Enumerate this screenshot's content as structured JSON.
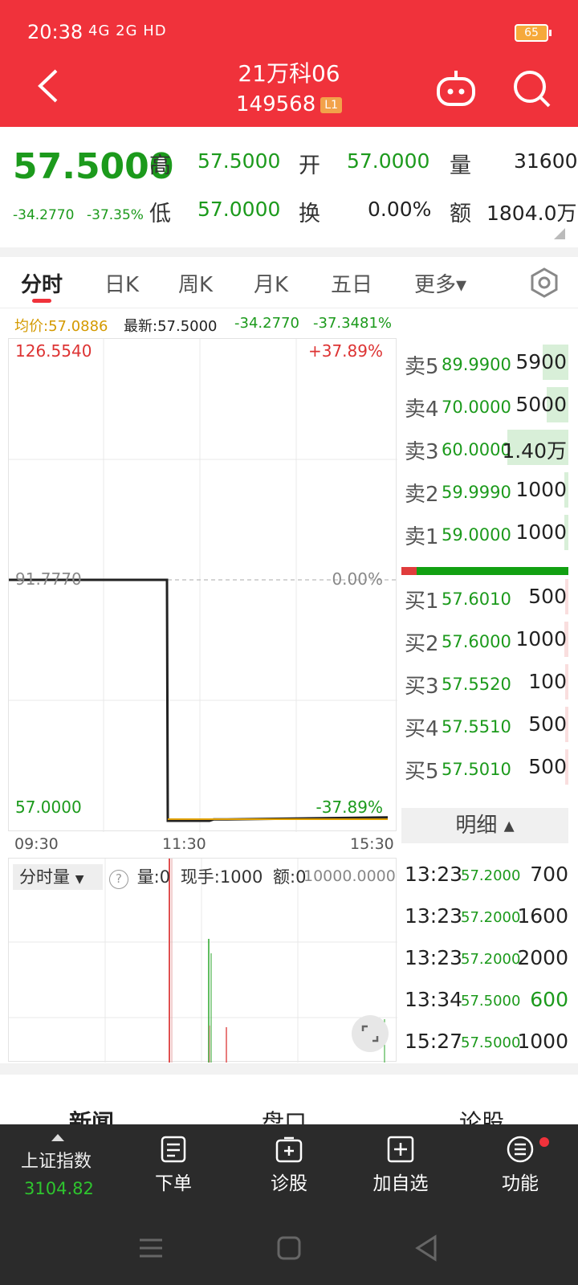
{
  "status_bar": {
    "time": "20:38",
    "signal_text": "4G 2G HD",
    "battery": "65"
  },
  "header": {
    "stock_name": "21万科06",
    "stock_code": "149568",
    "level_badge": "L1"
  },
  "quote": {
    "price": "57.5000",
    "change": "-34.2770",
    "change_pct": "-37.35%",
    "high_label": "高",
    "high": "57.5000",
    "open_label": "开",
    "open": "57.0000",
    "volume_label": "量",
    "volume": "31600",
    "low_label": "低",
    "low": "57.0000",
    "turnover_label": "换",
    "turnover": "0.00%",
    "amount_label": "额",
    "amount": "1804.0万"
  },
  "tabs": [
    "分时",
    "日K",
    "周K",
    "月K",
    "五日",
    "更多▾"
  ],
  "legend": {
    "avg": "均价:57.0886",
    "latest": "最新:57.5000",
    "chg": "-34.2770",
    "pct": "-37.3481%"
  },
  "chart_data": {
    "type": "line",
    "y_top": "126.5540",
    "y_mid": "91.7770",
    "y_bottom": "57.0000",
    "pct_top": "+37.89%",
    "pct_mid": "0.00%",
    "pct_bottom": "-37.89%",
    "x_labels": [
      "09:30",
      "11:30",
      "15:30"
    ],
    "ylim": [
      57.0,
      126.554
    ],
    "series": [
      {
        "values": [
          91.777,
          91.777,
          57.0,
          57.0,
          57.2,
          57.2,
          57.5
        ]
      }
    ]
  },
  "volume_panel": {
    "dropdown": "分时量",
    "help": "?",
    "vol": "量:0",
    "hand": "现手:1000",
    "amt": "额:0",
    "max": "10000.0000"
  },
  "order_book": {
    "asks": [
      {
        "label": "卖5",
        "price": "89.9900",
        "vol": "5900",
        "ratio": 0.42
      },
      {
        "label": "卖4",
        "price": "70.0000",
        "vol": "5000",
        "ratio": 0.36
      },
      {
        "label": "卖3",
        "price": "60.0000",
        "vol": "1.40万",
        "ratio": 1.0
      },
      {
        "label": "卖2",
        "price": "59.9990",
        "vol": "1000",
        "ratio": 0.07
      },
      {
        "label": "卖1",
        "price": "59.0000",
        "vol": "1000",
        "ratio": 0.07
      }
    ],
    "bids": [
      {
        "label": "买1",
        "price": "57.6010",
        "vol": "500",
        "ratio": 0.04
      },
      {
        "label": "买2",
        "price": "57.6000",
        "vol": "1000",
        "ratio": 0.07
      },
      {
        "label": "买3",
        "price": "57.5520",
        "vol": "100",
        "ratio": 0.01
      },
      {
        "label": "买4",
        "price": "57.5510",
        "vol": "500",
        "ratio": 0.04
      },
      {
        "label": "买5",
        "price": "57.5010",
        "vol": "500",
        "ratio": 0.04
      }
    ],
    "buy_ratio": 0.09
  },
  "detail": {
    "header": "明细 ▴",
    "trades": [
      {
        "time": "13:23",
        "price": "57.2000",
        "vol": "700",
        "color": "#222222"
      },
      {
        "time": "13:23",
        "price": "57.2000",
        "vol": "1600",
        "color": "#222222"
      },
      {
        "time": "13:23",
        "price": "57.2000",
        "vol": "2000",
        "color": "#222222"
      },
      {
        "time": "13:34",
        "price": "57.5000",
        "vol": "600",
        "color": "#1c9a1c"
      },
      {
        "time": "15:27",
        "price": "57.5000",
        "vol": "1000",
        "color": "#222222"
      }
    ]
  },
  "bottom_tabs": [
    "新闻",
    "盘口",
    "论股"
  ],
  "toolbar": {
    "index_name": "上证指数",
    "index_value": "3104.82",
    "items": [
      {
        "label": "下单",
        "icon": "order-icon"
      },
      {
        "label": "诊股",
        "icon": "diagnose-icon"
      },
      {
        "label": "加自选",
        "icon": "add-watchlist-icon"
      },
      {
        "label": "功能",
        "icon": "function-menu-icon"
      }
    ]
  },
  "colors": {
    "header_red": "#f0323b",
    "down_green": "#1c9a1c",
    "avg_line": "#e0a000"
  }
}
